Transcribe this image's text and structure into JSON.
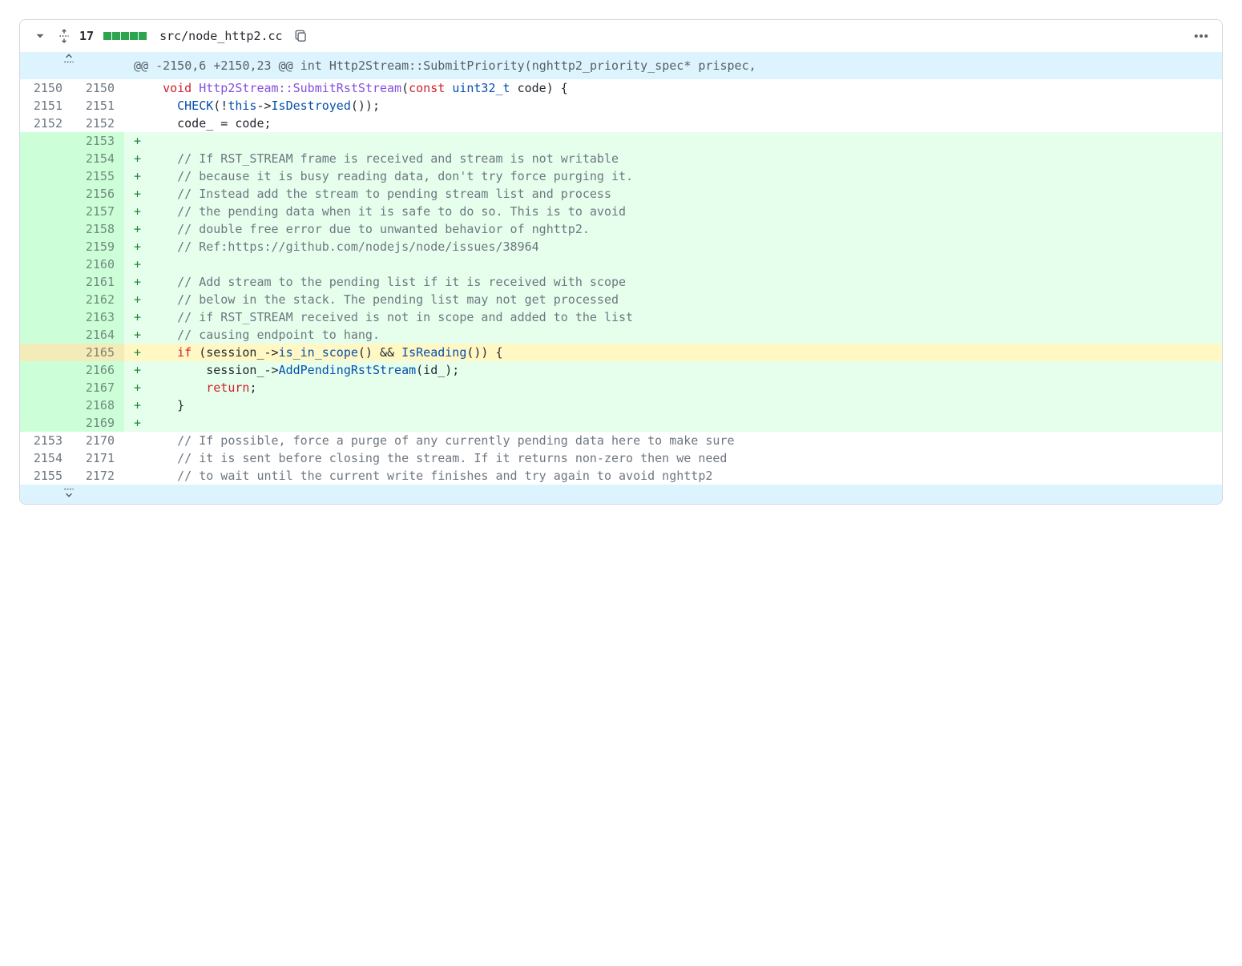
{
  "header": {
    "diff_count": "17",
    "path": "src/node_http2.cc"
  },
  "hunk": "@@ -2150,6 +2150,23 @@ int Http2Stream::SubmitPriority(nghttp2_priority_spec* prispec,",
  "lines": [
    {
      "oldN": "2150",
      "newN": "2150",
      "type": "ctx",
      "marker": " ",
      "tokens": [
        {
          "t": "  ",
          "c": ""
        },
        {
          "t": "void",
          "c": "k-red"
        },
        {
          "t": " ",
          "c": ""
        },
        {
          "t": "Http2Stream::SubmitRstStream",
          "c": "k-fn"
        },
        {
          "t": "(",
          "c": ""
        },
        {
          "t": "const",
          "c": "k-red"
        },
        {
          "t": " ",
          "c": ""
        },
        {
          "t": "uint32_t",
          "c": "k-blue"
        },
        {
          "t": " code) {",
          "c": ""
        }
      ]
    },
    {
      "oldN": "2151",
      "newN": "2151",
      "type": "ctx",
      "marker": " ",
      "tokens": [
        {
          "t": "    ",
          "c": ""
        },
        {
          "t": "CHECK",
          "c": "k-blue"
        },
        {
          "t": "(!",
          "c": ""
        },
        {
          "t": "this",
          "c": "k-blue"
        },
        {
          "t": "->",
          "c": ""
        },
        {
          "t": "IsDestroyed",
          "c": "k-blue"
        },
        {
          "t": "());",
          "c": ""
        }
      ]
    },
    {
      "oldN": "2152",
      "newN": "2152",
      "type": "ctx",
      "marker": " ",
      "tokens": [
        {
          "t": "    code_ = code;",
          "c": ""
        }
      ]
    },
    {
      "oldN": "",
      "newN": "2153",
      "type": "add",
      "marker": "+",
      "tokens": [
        {
          "t": "",
          "c": ""
        }
      ]
    },
    {
      "oldN": "",
      "newN": "2154",
      "type": "add",
      "marker": "+",
      "tokens": [
        {
          "t": "    ",
          "c": ""
        },
        {
          "t": "// If RST_STREAM frame is received and stream is not writable",
          "c": "k-cmt"
        }
      ]
    },
    {
      "oldN": "",
      "newN": "2155",
      "type": "add",
      "marker": "+",
      "tokens": [
        {
          "t": "    ",
          "c": ""
        },
        {
          "t": "// because it is busy reading data, don't try force purging it.",
          "c": "k-cmt"
        }
      ]
    },
    {
      "oldN": "",
      "newN": "2156",
      "type": "add",
      "marker": "+",
      "tokens": [
        {
          "t": "    ",
          "c": ""
        },
        {
          "t": "// Instead add the stream to pending stream list and process",
          "c": "k-cmt"
        }
      ]
    },
    {
      "oldN": "",
      "newN": "2157",
      "type": "add",
      "marker": "+",
      "tokens": [
        {
          "t": "    ",
          "c": ""
        },
        {
          "t": "// the pending data when it is safe to do so. This is to avoid",
          "c": "k-cmt"
        }
      ]
    },
    {
      "oldN": "",
      "newN": "2158",
      "type": "add",
      "marker": "+",
      "tokens": [
        {
          "t": "    ",
          "c": ""
        },
        {
          "t": "// double free error due to unwanted behavior of nghttp2.",
          "c": "k-cmt"
        }
      ]
    },
    {
      "oldN": "",
      "newN": "2159",
      "type": "add",
      "marker": "+",
      "tokens": [
        {
          "t": "    ",
          "c": ""
        },
        {
          "t": "// Ref:https://github.com/nodejs/node/issues/38964",
          "c": "k-cmt"
        }
      ]
    },
    {
      "oldN": "",
      "newN": "2160",
      "type": "add",
      "marker": "+",
      "tokens": [
        {
          "t": "",
          "c": ""
        }
      ]
    },
    {
      "oldN": "",
      "newN": "2161",
      "type": "add",
      "marker": "+",
      "tokens": [
        {
          "t": "    ",
          "c": ""
        },
        {
          "t": "// Add stream to the pending list if it is received with scope",
          "c": "k-cmt"
        }
      ]
    },
    {
      "oldN": "",
      "newN": "2162",
      "type": "add",
      "marker": "+",
      "tokens": [
        {
          "t": "    ",
          "c": ""
        },
        {
          "t": "// below in the stack. The pending list may not get processed",
          "c": "k-cmt"
        }
      ]
    },
    {
      "oldN": "",
      "newN": "2163",
      "type": "add",
      "marker": "+",
      "tokens": [
        {
          "t": "    ",
          "c": ""
        },
        {
          "t": "// if RST_STREAM received is not in scope and added to the list",
          "c": "k-cmt"
        }
      ]
    },
    {
      "oldN": "",
      "newN": "2164",
      "type": "add",
      "marker": "+",
      "tokens": [
        {
          "t": "    ",
          "c": ""
        },
        {
          "t": "// causing endpoint to hang.",
          "c": "k-cmt"
        }
      ]
    },
    {
      "oldN": "",
      "newN": "2165",
      "type": "add",
      "hl": true,
      "marker": "+",
      "tokens": [
        {
          "t": "    ",
          "c": ""
        },
        {
          "t": "if",
          "c": "k-red"
        },
        {
          "t": " (session_->",
          "c": ""
        },
        {
          "t": "is_in_scope",
          "c": "k-blue"
        },
        {
          "t": "() && ",
          "c": ""
        },
        {
          "t": "IsReading",
          "c": "k-blue"
        },
        {
          "t": "()) {",
          "c": ""
        }
      ]
    },
    {
      "oldN": "",
      "newN": "2166",
      "type": "add",
      "marker": "+",
      "tokens": [
        {
          "t": "        session_->",
          "c": ""
        },
        {
          "t": "AddPendingRstStream",
          "c": "k-blue"
        },
        {
          "t": "(id_);",
          "c": ""
        }
      ]
    },
    {
      "oldN": "",
      "newN": "2167",
      "type": "add",
      "marker": "+",
      "tokens": [
        {
          "t": "        ",
          "c": ""
        },
        {
          "t": "return",
          "c": "k-red"
        },
        {
          "t": ";",
          "c": ""
        }
      ]
    },
    {
      "oldN": "",
      "newN": "2168",
      "type": "add",
      "marker": "+",
      "tokens": [
        {
          "t": "    }",
          "c": ""
        }
      ]
    },
    {
      "oldN": "",
      "newN": "2169",
      "type": "add",
      "marker": "+",
      "tokens": [
        {
          "t": "",
          "c": ""
        }
      ]
    },
    {
      "oldN": "2153",
      "newN": "2170",
      "type": "ctx",
      "marker": " ",
      "tokens": [
        {
          "t": "    ",
          "c": ""
        },
        {
          "t": "// If possible, force a purge of any currently pending data here to make sure",
          "c": "k-cmt"
        }
      ]
    },
    {
      "oldN": "2154",
      "newN": "2171",
      "type": "ctx",
      "marker": " ",
      "tokens": [
        {
          "t": "    ",
          "c": ""
        },
        {
          "t": "// it is sent before closing the stream. If it returns non-zero then we need",
          "c": "k-cmt"
        }
      ]
    },
    {
      "oldN": "2155",
      "newN": "2172",
      "type": "ctx",
      "marker": " ",
      "tokens": [
        {
          "t": "    ",
          "c": ""
        },
        {
          "t": "// to wait until the current write finishes and try again to avoid nghttp2",
          "c": "k-cmt"
        }
      ]
    }
  ]
}
